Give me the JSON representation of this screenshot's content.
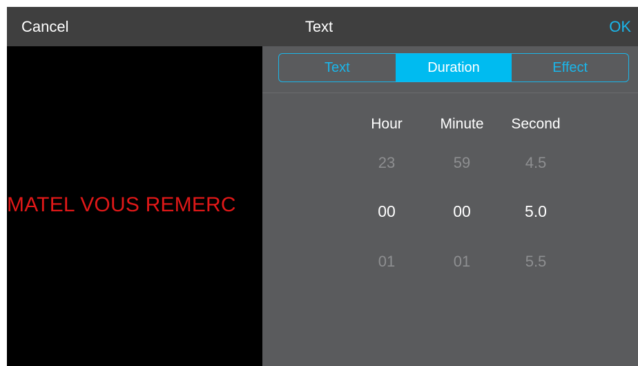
{
  "header": {
    "cancel_label": "Cancel",
    "title": "Text",
    "ok_label": "OK"
  },
  "preview": {
    "scrolling_text": "MATEL VOUS REMERC",
    "text_color": "#e01818",
    "background_color": "#000000"
  },
  "tabs": [
    {
      "label": "Text",
      "active": false
    },
    {
      "label": "Duration",
      "active": true
    },
    {
      "label": "Effect",
      "active": false
    }
  ],
  "picker": {
    "columns": [
      {
        "label": "Hour",
        "prev": "23",
        "selected": "00",
        "next": "01"
      },
      {
        "label": "Minute",
        "prev": "59",
        "selected": "00",
        "next": "01"
      },
      {
        "label": "Second",
        "prev": "4.5",
        "selected": "5.0",
        "next": "5.5"
      }
    ]
  },
  "colors": {
    "accent": "#1ab6ea",
    "active_tab": "#00bbf0",
    "header_bg": "#3f3f3f",
    "panel_bg": "#5a5b5d"
  }
}
